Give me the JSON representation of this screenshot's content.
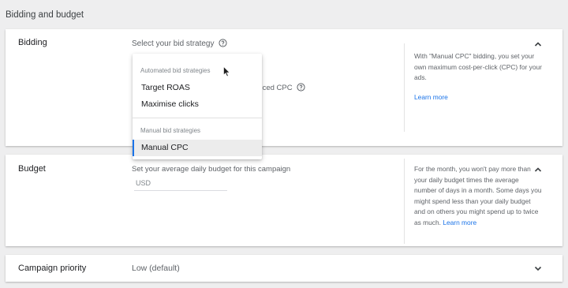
{
  "section_title": "Bidding and budget",
  "bidding": {
    "label": "Bidding",
    "prompt": "Select your bid strategy",
    "enhanced_text": "anced CPC",
    "info_text": "With \"Manual CPC\" bidding, you set your own maximum cost-per-click (CPC) for your ads.",
    "learn_more": "Learn more",
    "dropdown": {
      "automated_header": "Automated bid strategies",
      "automated_items": [
        "Target ROAS",
        "Maximise clicks"
      ],
      "manual_header": "Manual bid strategies",
      "manual_items": [
        "Manual CPC"
      ],
      "selected": "Manual CPC"
    }
  },
  "budget": {
    "label": "Budget",
    "prompt": "Set your average daily budget for this campaign",
    "currency_placeholder": "USD",
    "info_text": "For the month, you won't pay more than your daily budget times the average number of days in a month. Some days you might spend less than your daily budget and on others you might spend up to twice as much.",
    "learn_more": "Learn more"
  },
  "priority": {
    "label": "Campaign priority",
    "value": "Low (default)"
  },
  "icons": {
    "help": "help-circle-icon",
    "expand_less": "chevron-up-icon",
    "expand_more": "chevron-down-icon",
    "pointer": "mouse-cursor-icon"
  },
  "colors": {
    "accent": "#1a73e8",
    "page_bg": "#eeeeef",
    "card_bg": "#ffffff",
    "selected_bg": "#ececec"
  }
}
